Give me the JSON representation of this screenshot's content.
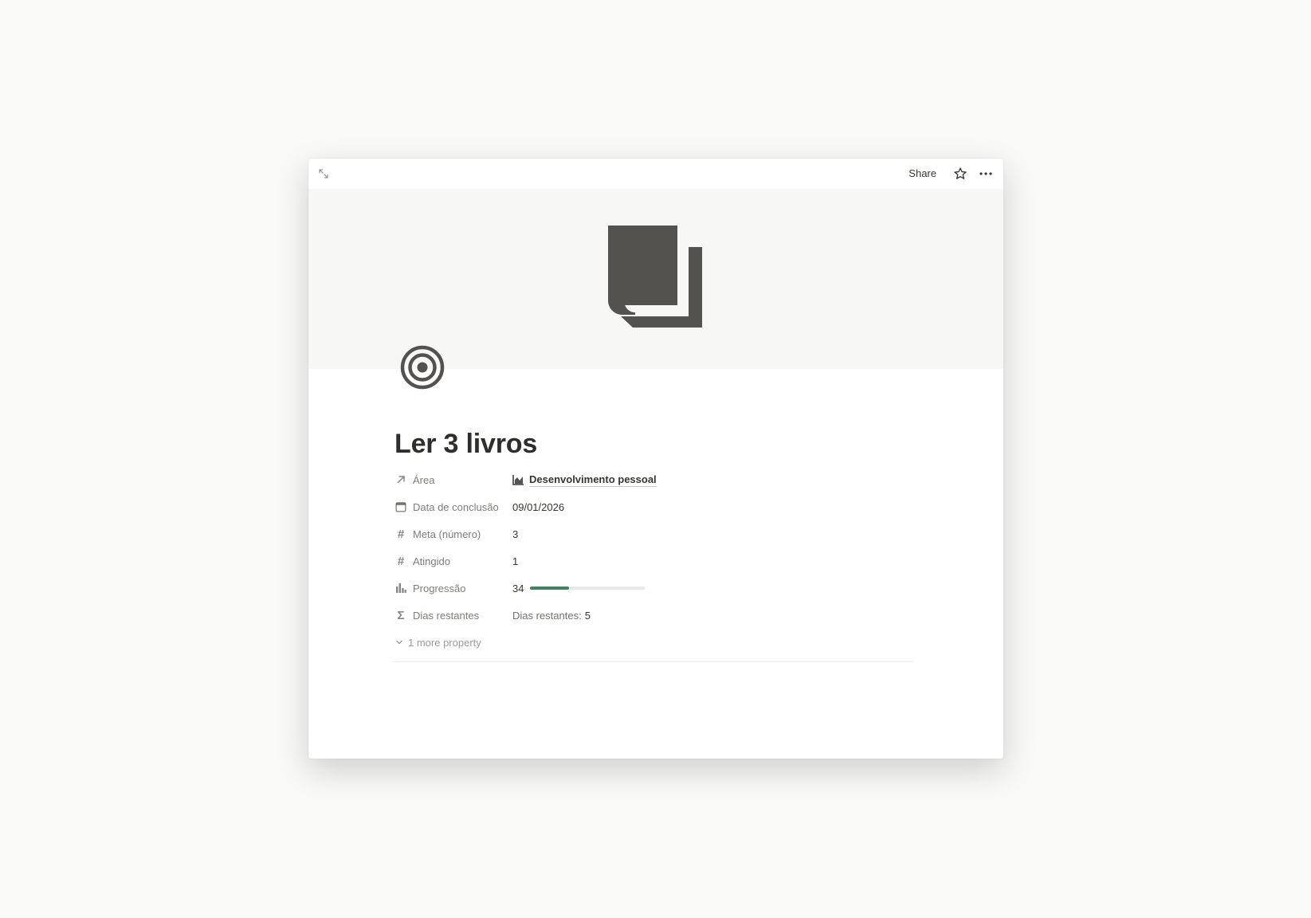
{
  "topbar": {
    "share_label": "Share",
    "icons": {
      "expand": "expand-arrows-icon",
      "favorite": "star-icon",
      "more": "more-dots-icon"
    }
  },
  "cover": {
    "icon": "book-copy-icon",
    "color": "#53524e"
  },
  "page": {
    "icon": "target-icon",
    "title": "Ler 3 livros"
  },
  "properties": [
    {
      "icon": "arrow-up-right-icon",
      "label": "Área",
      "value": "Desenvolvimento pessoal",
      "value_icon": "area-chart-icon"
    },
    {
      "icon": "calendar-icon",
      "label": "Data de conclusão",
      "value": "09/01/2026"
    },
    {
      "icon": "hash-icon",
      "label": "Meta (número)",
      "value": "3"
    },
    {
      "icon": "hash-icon",
      "label": "Atingido",
      "value": "1"
    },
    {
      "icon": "bar-chart-icon",
      "label": "Progressão",
      "value": "34",
      "progress_percent": 34,
      "progress_color": "#448361"
    },
    {
      "icon": "sigma-icon",
      "label": "Dias restantes",
      "value_prefix": "Dias restantes:",
      "value": "5"
    }
  ],
  "more_properties_label": "1 more property"
}
